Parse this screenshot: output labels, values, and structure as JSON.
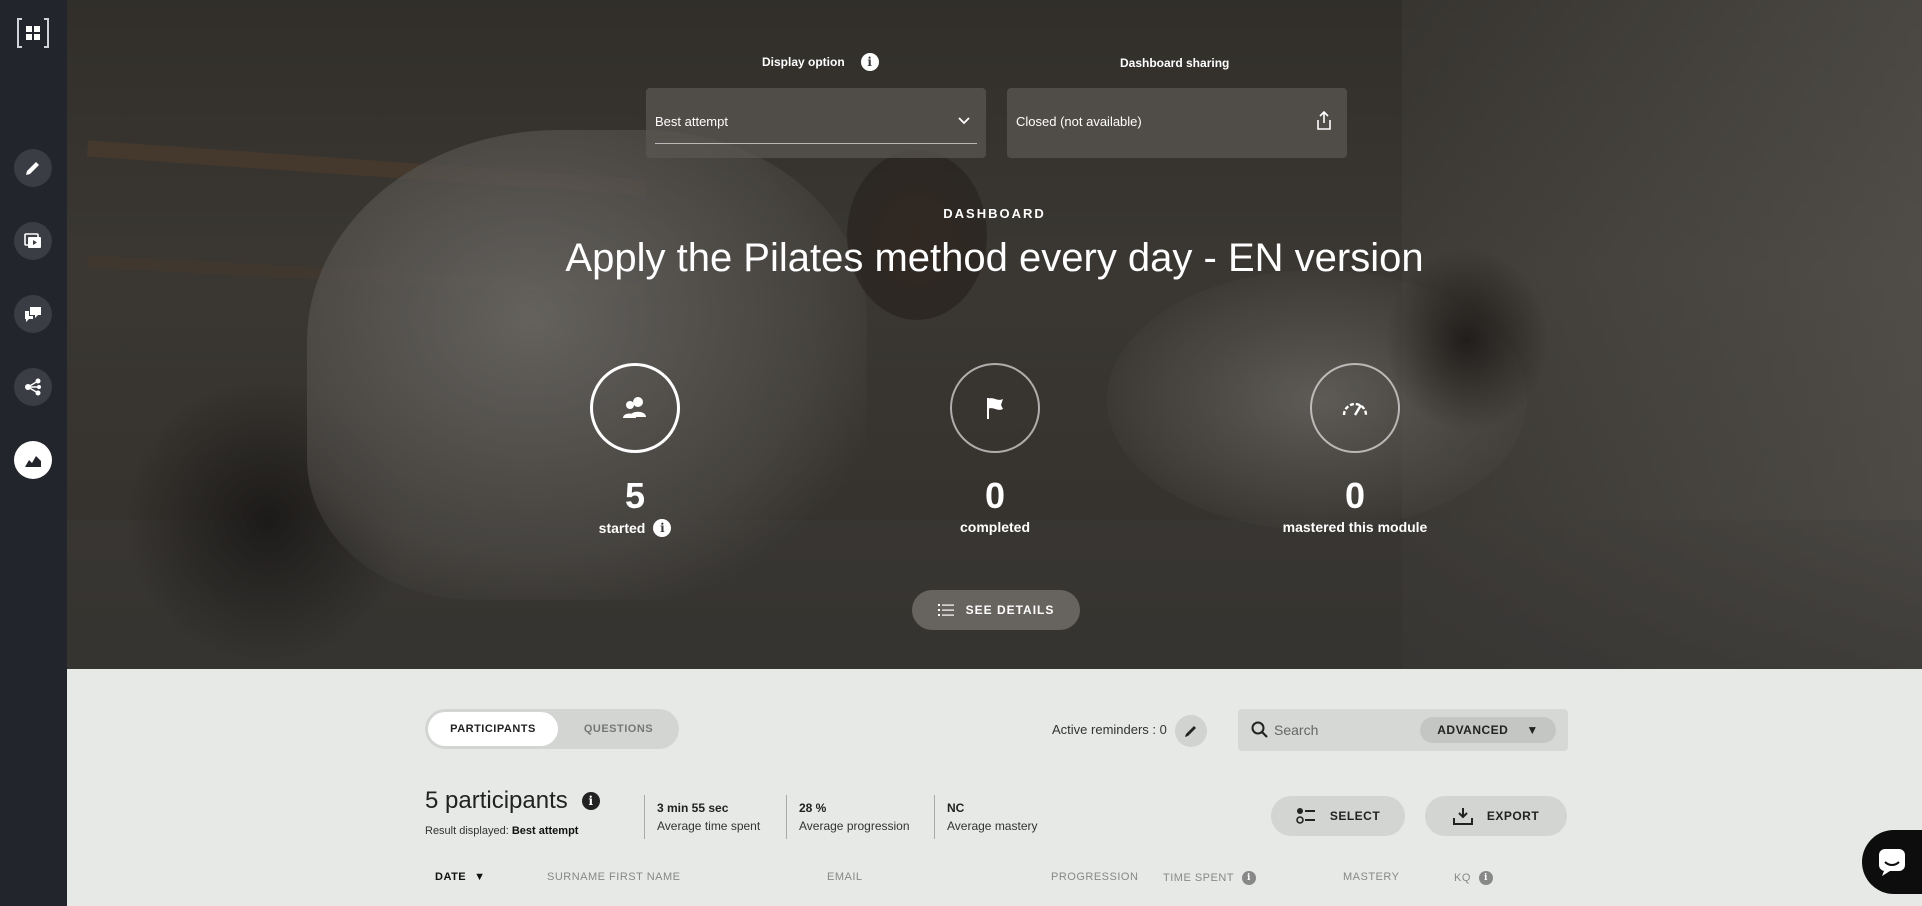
{
  "sidebar": {
    "items": [
      {
        "icon": "pencil-icon"
      },
      {
        "icon": "media-icon"
      },
      {
        "icon": "chat-icon"
      },
      {
        "icon": "share-nodes-icon"
      },
      {
        "icon": "analytics-icon",
        "active": true
      }
    ]
  },
  "controls": {
    "display_option_label": "Display option",
    "display_option_value": "Best attempt",
    "dashboard_sharing_label": "Dashboard sharing",
    "dashboard_sharing_value": "Closed (not available)"
  },
  "hero": {
    "kicker": "DASHBOARD",
    "title": "Apply the Pilates method every day - EN version",
    "stats": [
      {
        "value": "5",
        "label": "started",
        "icon": "users-icon"
      },
      {
        "value": "0",
        "label": "completed",
        "icon": "flag-icon"
      },
      {
        "value": "0",
        "label": "mastered this module",
        "icon": "gauge-icon"
      }
    ],
    "see_details": "SEE DETAILS"
  },
  "panel": {
    "tabs": [
      "PARTICIPANTS",
      "QUESTIONS"
    ],
    "active_reminders_label": "Active reminders : 0",
    "search_placeholder": "Search",
    "advanced_label": "ADVANCED",
    "participants_count": "5 participants",
    "result_displayed_prefix": "Result displayed:",
    "result_displayed_value": "Best attempt",
    "metrics": [
      {
        "value": "3 min 55 sec",
        "label": "Average time spent"
      },
      {
        "value": "28 %",
        "label": "Average progression"
      },
      {
        "value": "NC",
        "label": "Average mastery"
      }
    ],
    "select_label": "SELECT",
    "export_label": "EXPORT",
    "columns": [
      "DATE",
      "SURNAME FIRST NAME",
      "EMAIL",
      "PROGRESSION",
      "TIME SPENT",
      "MASTERY",
      "KQ"
    ]
  },
  "colors": {
    "sidebar_bg": "#22252b",
    "panel_bg": "#e6e9e6",
    "accent_white": "#ffffff"
  }
}
